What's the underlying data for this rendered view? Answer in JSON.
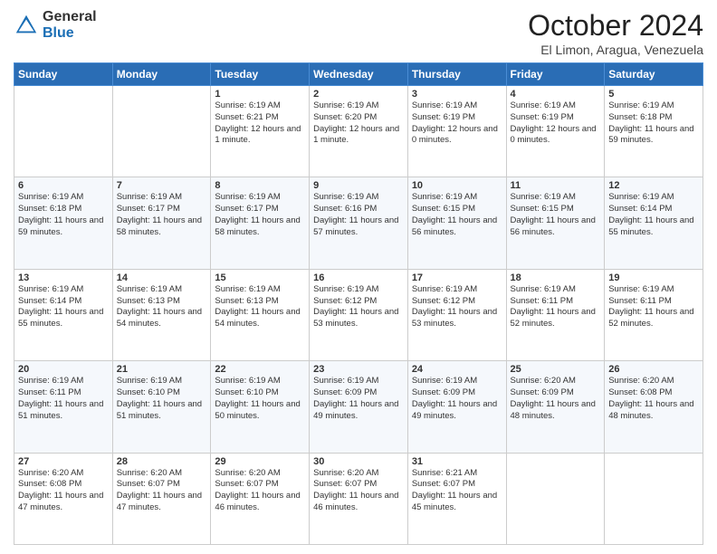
{
  "header": {
    "logo_general": "General",
    "logo_blue": "Blue",
    "month_title": "October 2024",
    "location": "El Limon, Aragua, Venezuela"
  },
  "days_of_week": [
    "Sunday",
    "Monday",
    "Tuesday",
    "Wednesday",
    "Thursday",
    "Friday",
    "Saturday"
  ],
  "weeks": [
    [
      {
        "day": "",
        "sunrise": "",
        "sunset": "",
        "daylight": ""
      },
      {
        "day": "",
        "sunrise": "",
        "sunset": "",
        "daylight": ""
      },
      {
        "day": "1",
        "sunrise": "Sunrise: 6:19 AM",
        "sunset": "Sunset: 6:21 PM",
        "daylight": "Daylight: 12 hours and 1 minute."
      },
      {
        "day": "2",
        "sunrise": "Sunrise: 6:19 AM",
        "sunset": "Sunset: 6:20 PM",
        "daylight": "Daylight: 12 hours and 1 minute."
      },
      {
        "day": "3",
        "sunrise": "Sunrise: 6:19 AM",
        "sunset": "Sunset: 6:19 PM",
        "daylight": "Daylight: 12 hours and 0 minutes."
      },
      {
        "day": "4",
        "sunrise": "Sunrise: 6:19 AM",
        "sunset": "Sunset: 6:19 PM",
        "daylight": "Daylight: 12 hours and 0 minutes."
      },
      {
        "day": "5",
        "sunrise": "Sunrise: 6:19 AM",
        "sunset": "Sunset: 6:18 PM",
        "daylight": "Daylight: 11 hours and 59 minutes."
      }
    ],
    [
      {
        "day": "6",
        "sunrise": "Sunrise: 6:19 AM",
        "sunset": "Sunset: 6:18 PM",
        "daylight": "Daylight: 11 hours and 59 minutes."
      },
      {
        "day": "7",
        "sunrise": "Sunrise: 6:19 AM",
        "sunset": "Sunset: 6:17 PM",
        "daylight": "Daylight: 11 hours and 58 minutes."
      },
      {
        "day": "8",
        "sunrise": "Sunrise: 6:19 AM",
        "sunset": "Sunset: 6:17 PM",
        "daylight": "Daylight: 11 hours and 58 minutes."
      },
      {
        "day": "9",
        "sunrise": "Sunrise: 6:19 AM",
        "sunset": "Sunset: 6:16 PM",
        "daylight": "Daylight: 11 hours and 57 minutes."
      },
      {
        "day": "10",
        "sunrise": "Sunrise: 6:19 AM",
        "sunset": "Sunset: 6:15 PM",
        "daylight": "Daylight: 11 hours and 56 minutes."
      },
      {
        "day": "11",
        "sunrise": "Sunrise: 6:19 AM",
        "sunset": "Sunset: 6:15 PM",
        "daylight": "Daylight: 11 hours and 56 minutes."
      },
      {
        "day": "12",
        "sunrise": "Sunrise: 6:19 AM",
        "sunset": "Sunset: 6:14 PM",
        "daylight": "Daylight: 11 hours and 55 minutes."
      }
    ],
    [
      {
        "day": "13",
        "sunrise": "Sunrise: 6:19 AM",
        "sunset": "Sunset: 6:14 PM",
        "daylight": "Daylight: 11 hours and 55 minutes."
      },
      {
        "day": "14",
        "sunrise": "Sunrise: 6:19 AM",
        "sunset": "Sunset: 6:13 PM",
        "daylight": "Daylight: 11 hours and 54 minutes."
      },
      {
        "day": "15",
        "sunrise": "Sunrise: 6:19 AM",
        "sunset": "Sunset: 6:13 PM",
        "daylight": "Daylight: 11 hours and 54 minutes."
      },
      {
        "day": "16",
        "sunrise": "Sunrise: 6:19 AM",
        "sunset": "Sunset: 6:12 PM",
        "daylight": "Daylight: 11 hours and 53 minutes."
      },
      {
        "day": "17",
        "sunrise": "Sunrise: 6:19 AM",
        "sunset": "Sunset: 6:12 PM",
        "daylight": "Daylight: 11 hours and 53 minutes."
      },
      {
        "day": "18",
        "sunrise": "Sunrise: 6:19 AM",
        "sunset": "Sunset: 6:11 PM",
        "daylight": "Daylight: 11 hours and 52 minutes."
      },
      {
        "day": "19",
        "sunrise": "Sunrise: 6:19 AM",
        "sunset": "Sunset: 6:11 PM",
        "daylight": "Daylight: 11 hours and 52 minutes."
      }
    ],
    [
      {
        "day": "20",
        "sunrise": "Sunrise: 6:19 AM",
        "sunset": "Sunset: 6:11 PM",
        "daylight": "Daylight: 11 hours and 51 minutes."
      },
      {
        "day": "21",
        "sunrise": "Sunrise: 6:19 AM",
        "sunset": "Sunset: 6:10 PM",
        "daylight": "Daylight: 11 hours and 51 minutes."
      },
      {
        "day": "22",
        "sunrise": "Sunrise: 6:19 AM",
        "sunset": "Sunset: 6:10 PM",
        "daylight": "Daylight: 11 hours and 50 minutes."
      },
      {
        "day": "23",
        "sunrise": "Sunrise: 6:19 AM",
        "sunset": "Sunset: 6:09 PM",
        "daylight": "Daylight: 11 hours and 49 minutes."
      },
      {
        "day": "24",
        "sunrise": "Sunrise: 6:19 AM",
        "sunset": "Sunset: 6:09 PM",
        "daylight": "Daylight: 11 hours and 49 minutes."
      },
      {
        "day": "25",
        "sunrise": "Sunrise: 6:20 AM",
        "sunset": "Sunset: 6:09 PM",
        "daylight": "Daylight: 11 hours and 48 minutes."
      },
      {
        "day": "26",
        "sunrise": "Sunrise: 6:20 AM",
        "sunset": "Sunset: 6:08 PM",
        "daylight": "Daylight: 11 hours and 48 minutes."
      }
    ],
    [
      {
        "day": "27",
        "sunrise": "Sunrise: 6:20 AM",
        "sunset": "Sunset: 6:08 PM",
        "daylight": "Daylight: 11 hours and 47 minutes."
      },
      {
        "day": "28",
        "sunrise": "Sunrise: 6:20 AM",
        "sunset": "Sunset: 6:07 PM",
        "daylight": "Daylight: 11 hours and 47 minutes."
      },
      {
        "day": "29",
        "sunrise": "Sunrise: 6:20 AM",
        "sunset": "Sunset: 6:07 PM",
        "daylight": "Daylight: 11 hours and 46 minutes."
      },
      {
        "day": "30",
        "sunrise": "Sunrise: 6:20 AM",
        "sunset": "Sunset: 6:07 PM",
        "daylight": "Daylight: 11 hours and 46 minutes."
      },
      {
        "day": "31",
        "sunrise": "Sunrise: 6:21 AM",
        "sunset": "Sunset: 6:07 PM",
        "daylight": "Daylight: 11 hours and 45 minutes."
      },
      {
        "day": "",
        "sunrise": "",
        "sunset": "",
        "daylight": ""
      },
      {
        "day": "",
        "sunrise": "",
        "sunset": "",
        "daylight": ""
      }
    ]
  ]
}
